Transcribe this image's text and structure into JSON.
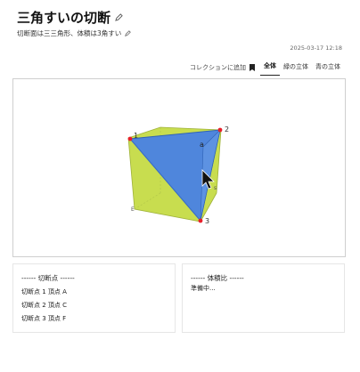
{
  "header": {
    "title": "三角すいの切断",
    "subtitle": "切断面は三三角形、体積は3角すい",
    "date": "2025-03-17 12:18"
  },
  "toolbar": {
    "collection_label": "コレクションに追加",
    "tabs": [
      {
        "label": "全体",
        "active": true
      },
      {
        "label": "緑の立体",
        "active": false
      },
      {
        "label": "青の立体",
        "active": false
      }
    ]
  },
  "viewer": {
    "vertex_labels": {
      "p1": "1",
      "p2": "2",
      "p3": "3",
      "top_back": "a",
      "right": "s",
      "bottom_left": "E"
    },
    "colors": {
      "cube_face": "#c8dd4f",
      "cut_face": "#4f86dc",
      "point": "#e8202a"
    }
  },
  "panels": {
    "cut_points": {
      "heading": "------ 切断点 ------",
      "items": [
        "切断点 1  頂点 A",
        "切断点 2  頂点 C",
        "切断点 3  頂点 F"
      ]
    },
    "volume_ratio": {
      "heading": "------ 体積比 ------",
      "status": "準備中..."
    }
  }
}
